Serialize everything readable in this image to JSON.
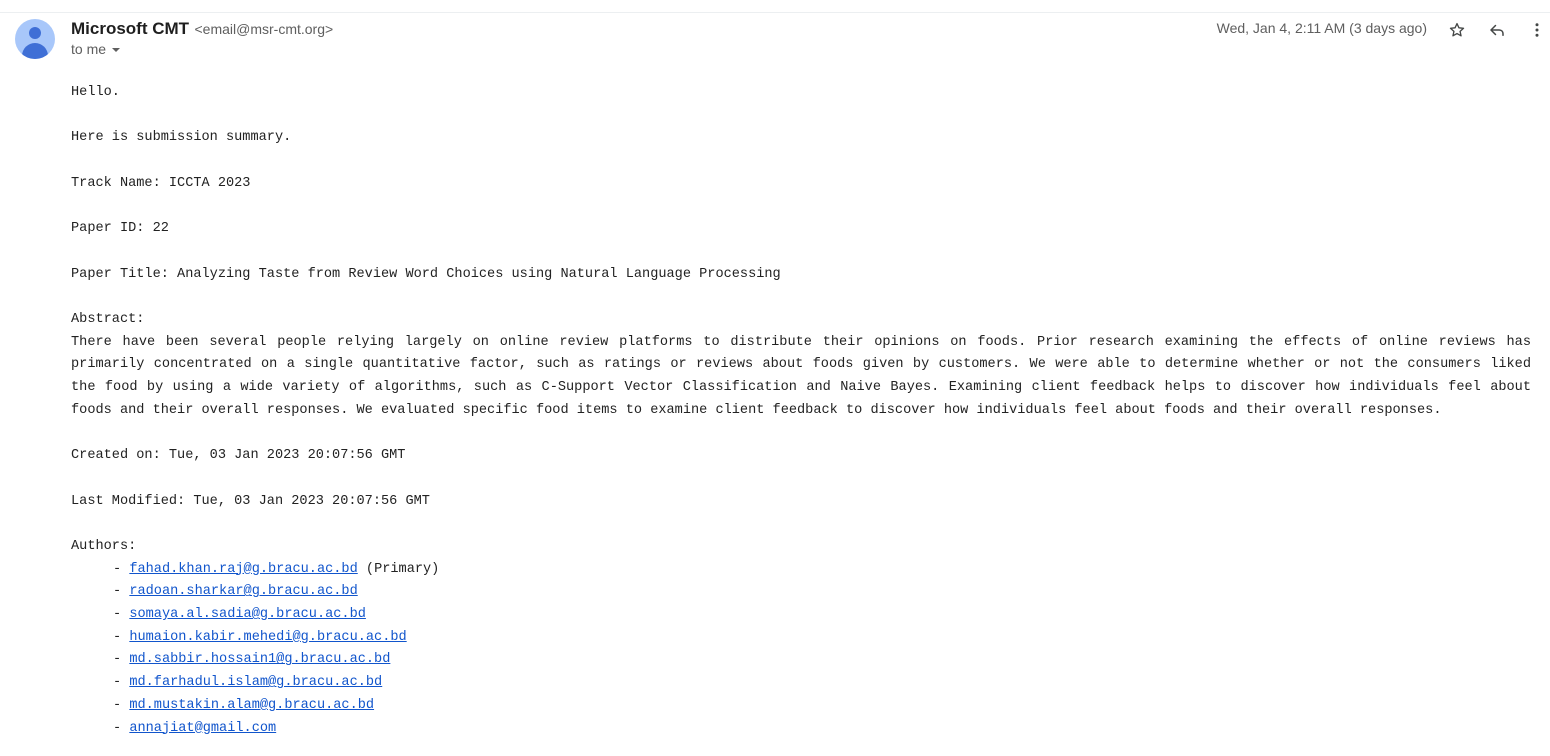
{
  "email": {
    "sender_name": "Microsoft CMT",
    "sender_email": "<email@msr-cmt.org>",
    "to": "to me",
    "date": "Wed, Jan 4, 2:11 AM (3 days ago)"
  },
  "icons": {
    "avatar": "person-avatar-icon",
    "star": "star-icon",
    "reply": "reply-icon",
    "more": "more-vert-icon"
  },
  "colors": {
    "link": "#1155cc",
    "avatar_bg": "#a8c7fa",
    "avatar_fg": "#3f6fd6"
  },
  "body": {
    "greeting": "Hello.",
    "intro": "Here is submission summary.",
    "track": "Track Name: ICCTA 2023",
    "paper_id": "Paper ID: 22",
    "paper_title": "Paper Title: Analyzing Taste from Review Word Choices using Natural Language Processing",
    "abstract_label": "Abstract:",
    "abstract_text": "There have been several people relying largely on online review platforms to distribute their opinions on foods. Prior research examining the effects of online reviews has primarily concentrated on a single quantitative factor, such as ratings or reviews about foods given by customers. We were able to determine whether or not the consumers liked the food by using a wide variety of algorithms, such as C-Support Vector Classification and Naive Bayes. Examining client feedback helps to discover how individuals feel about foods and their overall responses. We evaluated specific food items to examine client feedback to discover how individuals feel about foods and their overall responses.",
    "created": "Created on: Tue, 03 Jan 2023 20:07:56 GMT",
    "modified": "Last Modified: Tue, 03 Jan 2023 20:07:56 GMT",
    "authors_label": "Authors:",
    "authors": [
      {
        "bullet": "- ",
        "email": "fahad.khan.raj@g.bracu.ac.bd",
        "note": " (Primary)"
      },
      {
        "bullet": "- ",
        "email": "radoan.sharkar@g.bracu.ac.bd",
        "note": ""
      },
      {
        "bullet": "- ",
        "email": "somaya.al.sadia@g.bracu.ac.bd",
        "note": ""
      },
      {
        "bullet": "- ",
        "email": "humaion.kabir.mehedi@g.bracu.ac.bd",
        "note": ""
      },
      {
        "bullet": "- ",
        "email": "md.sabbir.hossain1@g.bracu.ac.bd",
        "note": ""
      },
      {
        "bullet": "- ",
        "email": "md.farhadul.islam@g.bracu.ac.bd",
        "note": ""
      },
      {
        "bullet": "- ",
        "email": "md.mustakin.alam@g.bracu.ac.bd",
        "note": ""
      },
      {
        "bullet": "- ",
        "email": "annajiat@gmail.com",
        "note": ""
      }
    ]
  }
}
